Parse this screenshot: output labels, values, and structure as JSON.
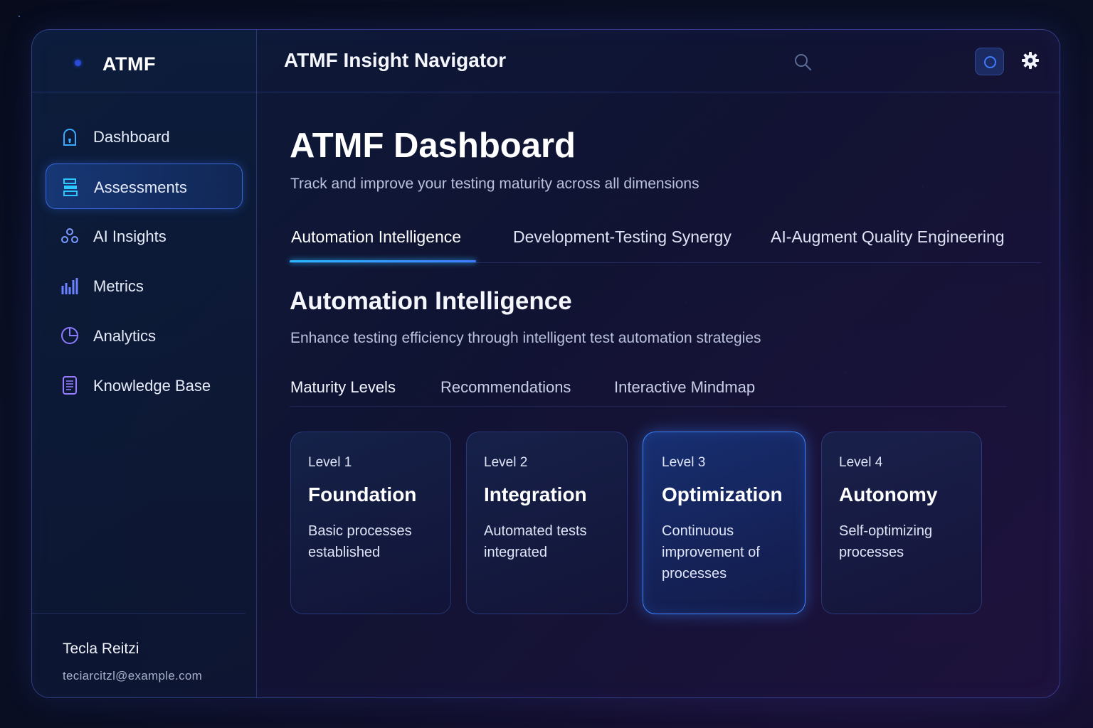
{
  "brand": {
    "name": "ATMF"
  },
  "header": {
    "title": "ATMF Insight Navigator"
  },
  "sidebar": {
    "items": [
      {
        "label": "Dashboard",
        "icon": "lock-icon",
        "active": false
      },
      {
        "label": "Assessments",
        "icon": "assessment-icon",
        "active": true
      },
      {
        "label": "AI Insights",
        "icon": "network-icon",
        "active": false
      },
      {
        "label": "Metrics",
        "icon": "bar-chart-icon",
        "active": false
      },
      {
        "label": "Analytics",
        "icon": "pie-chart-icon",
        "active": false
      },
      {
        "label": "Knowledge Base",
        "icon": "document-icon",
        "active": false
      }
    ],
    "user": {
      "name": "Tecla Reitzi",
      "email": "teciarcitzl@example.com"
    }
  },
  "main": {
    "title": "ATMF Dashboard",
    "subtitle": "Track and improve your testing maturity across all dimensions",
    "tabs": [
      {
        "label": "Automation Intelligence",
        "active": true
      },
      {
        "label": "Development-Testing Synergy",
        "active": false
      },
      {
        "label": "AI-Augment Quality Engineering",
        "active": false
      }
    ],
    "section": {
      "title": "Automation Intelligence",
      "subtitle": "Enhance testing efficiency through intelligent test automation strategies"
    },
    "subtabs": [
      {
        "label": "Maturity Levels",
        "active": true
      },
      {
        "label": "Recommendations",
        "active": false
      },
      {
        "label": "Interactive Mindmap",
        "active": false
      }
    ],
    "levels": [
      {
        "level": "Level 1",
        "name": "Foundation",
        "desc": "Basic processes established",
        "active": false
      },
      {
        "level": "Level 2",
        "name": "Integration",
        "desc": "Automated tests integrated",
        "active": false
      },
      {
        "level": "Level 3",
        "name": "Optimization",
        "desc": "Continuous improvement of processes",
        "active": true
      },
      {
        "level": "Level 4",
        "name": "Autonomy",
        "desc": "Self-optimizing processes",
        "active": false
      }
    ]
  },
  "colors": {
    "accent": "#3f7bff",
    "underline": "#2bb8ff",
    "background": "#0a0f24"
  }
}
